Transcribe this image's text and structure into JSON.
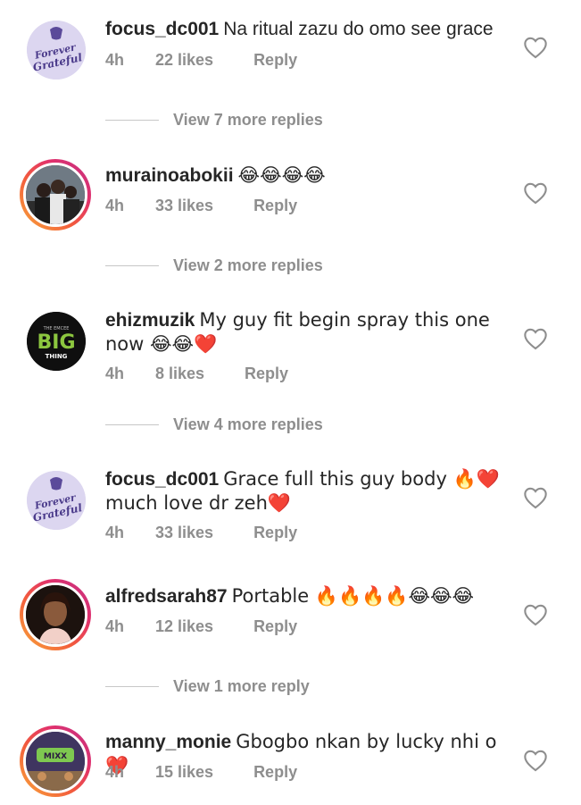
{
  "comments": [
    {
      "username": "focus_dc001",
      "text": "Na ritual zazu do omo see grace",
      "time": "4h",
      "likes": "22 likes",
      "reply": "Reply",
      "avatar_text": "Forever Grateful",
      "more_replies": "View 7 more replies"
    },
    {
      "username": "murainoabokii",
      "text": "😂😂😂😂",
      "time": "4h",
      "likes": "33 likes",
      "reply": "Reply",
      "more_replies": "View 2 more replies"
    },
    {
      "username": "ehizmuzik",
      "text": "My guy fit begin spray this one now 😂😂❤️",
      "time": "4h",
      "likes": "8 likes",
      "reply": "Reply",
      "avatar_text": "BIG",
      "avatar_subtext": "THING",
      "avatar_top": "THE EMCEE",
      "more_replies": "View 4 more replies"
    },
    {
      "username": "focus_dc001",
      "text": "Grace full this guy body 🔥❤️ much love dr zeh❤️",
      "time": "4h",
      "likes": "33 likes",
      "reply": "Reply",
      "avatar_text": "Forever Grateful"
    },
    {
      "username": "alfredsarah87",
      "text": "Portable 🔥🔥🔥🔥😂😂😂",
      "time": "4h",
      "likes": "12 likes",
      "reply": "Reply",
      "more_replies": "View 1 more reply"
    },
    {
      "username": "manny_monie",
      "text": "Gbogbo nkan by lucky nhi o ❤️",
      "time": "4h",
      "likes": "15 likes",
      "reply": "Reply"
    }
  ],
  "colors": {
    "text": "#262626",
    "meta": "#8e8e8e",
    "ring_start": "#f9a93a",
    "ring_end": "#c13584"
  },
  "icons": {
    "like": "heart-outline-icon"
  }
}
